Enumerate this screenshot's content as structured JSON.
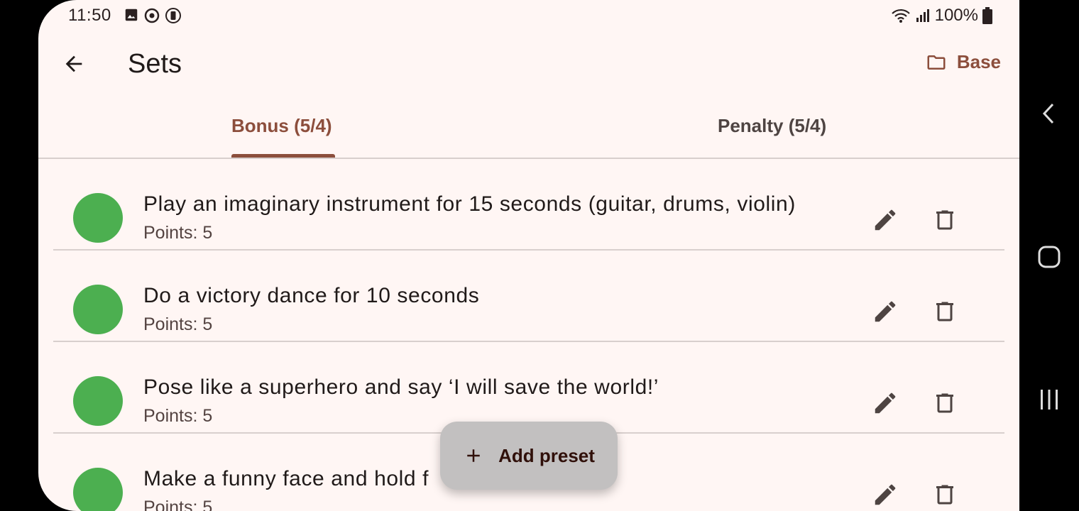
{
  "status": {
    "time": "11:50",
    "battery": "100%",
    "left_icons": [
      "image-icon",
      "sync-icon",
      "screen-record-icon"
    ],
    "right_icons": [
      "wifi-icon",
      "signal-icon",
      "battery-icon"
    ]
  },
  "appbar": {
    "title": "Sets",
    "base_label": "Base"
  },
  "tabs": [
    {
      "label": "Bonus (5/4)",
      "selected": true
    },
    {
      "label": "Penalty (5/4)",
      "selected": false
    }
  ],
  "items": [
    {
      "title": "Play an imaginary instrument for 15 seconds (guitar, drums, violin)",
      "points": "Points: 5"
    },
    {
      "title": "Do a victory dance for 10 seconds",
      "points": "Points: 5"
    },
    {
      "title": "Pose like a superhero and say ‘I will save the world!’",
      "points": "Points: 5"
    },
    {
      "title": "Make a funny face and hold f",
      "points": "Points: 5"
    }
  ],
  "fab": {
    "label": "Add preset"
  },
  "colors": {
    "accent": "#8c4e3c",
    "dot": "#4caf50",
    "background": "#fff6f4",
    "fab": "#c2c0c0"
  }
}
